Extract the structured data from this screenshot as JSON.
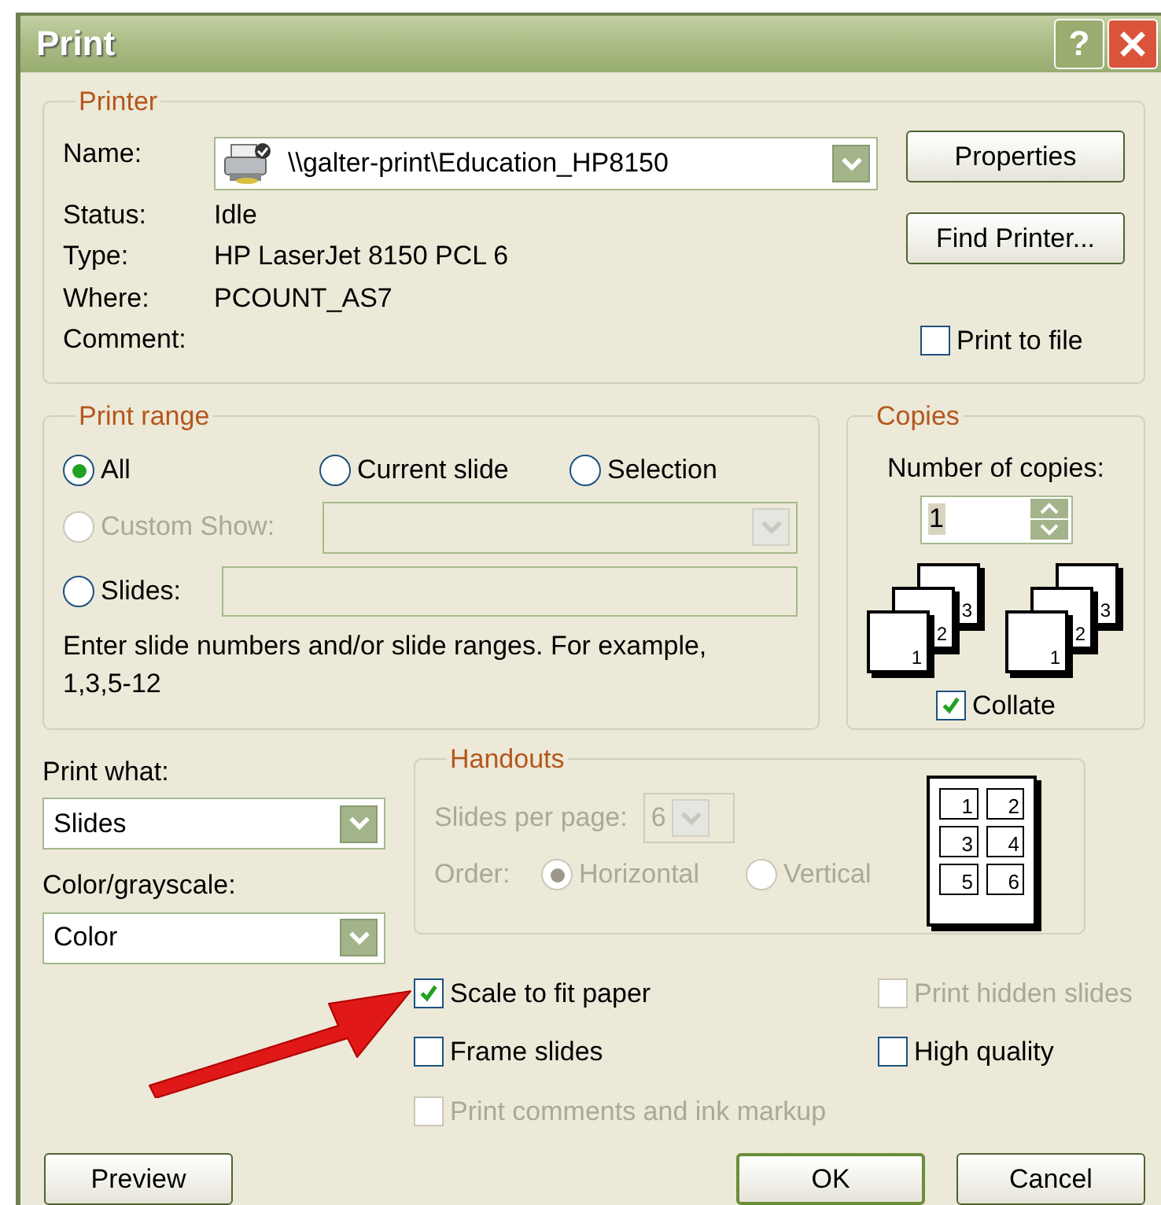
{
  "window": {
    "title": "Print",
    "help": "?"
  },
  "printer": {
    "legend": "Printer",
    "name_label": "Name:",
    "name_value": "\\\\galter-print\\Education_HP8150",
    "info": [
      {
        "label": "Status:",
        "value": "Idle"
      },
      {
        "label": "Type:",
        "value": "HP LaserJet 8150 PCL 6"
      },
      {
        "label": "Where:",
        "value": "PCOUNT_AS7"
      },
      {
        "label": "Comment:"
      }
    ],
    "buttons": [
      "Properties",
      "Find Printer..."
    ],
    "print_to_file": {
      "label": "Print to file",
      "checked": false
    }
  },
  "print_range": {
    "legend": "Print range",
    "options": [
      {
        "label": "All",
        "selected": true,
        "disabled": false
      },
      {
        "label": "Current slide",
        "selected": false,
        "disabled": false
      },
      {
        "label": "Selection",
        "selected": false,
        "disabled": false
      },
      {
        "label": "Custom Show:",
        "selected": false,
        "disabled": true
      },
      {
        "label": "Slides:",
        "selected": false,
        "disabled": false
      }
    ],
    "hint": "Enter slide numbers and/or slide ranges. For example, 1,3,5-12"
  },
  "copies": {
    "legend": "Copies",
    "label": "Number of copies:",
    "value": "1",
    "stacks": [
      [
        "1",
        "2",
        "3"
      ],
      [
        "1",
        "2",
        "3"
      ]
    ],
    "collate": {
      "label": "Collate",
      "checked": true
    }
  },
  "print_what": {
    "label": "Print what:",
    "value": "Slides"
  },
  "color_grayscale": {
    "label": "Color/grayscale:",
    "value": "Color"
  },
  "handouts": {
    "legend": "Handouts",
    "slides_per_page_label": "Slides per page:",
    "slides_per_page": "6",
    "order_label": "Order:",
    "order": [
      {
        "label": "Horizontal",
        "selected": true
      },
      {
        "label": "Vertical",
        "selected": false
      }
    ],
    "slot_labels": [
      "1",
      "2",
      "3",
      "4",
      "5",
      "6"
    ]
  },
  "options": [
    {
      "label": "Scale to fit paper",
      "checked": true,
      "disabled": false
    },
    {
      "label": "Print hidden slides",
      "checked": false,
      "disabled": true
    },
    {
      "label": "Frame slides",
      "checked": false,
      "disabled": false
    },
    {
      "label": "High quality",
      "checked": false,
      "disabled": false
    },
    {
      "label": "Print comments and ink markup",
      "checked": false,
      "disabled": true
    }
  ],
  "buttons": [
    {
      "label": "Preview",
      "default": false
    },
    {
      "label": "OK",
      "default": true
    },
    {
      "label": "Cancel",
      "default": false
    }
  ]
}
